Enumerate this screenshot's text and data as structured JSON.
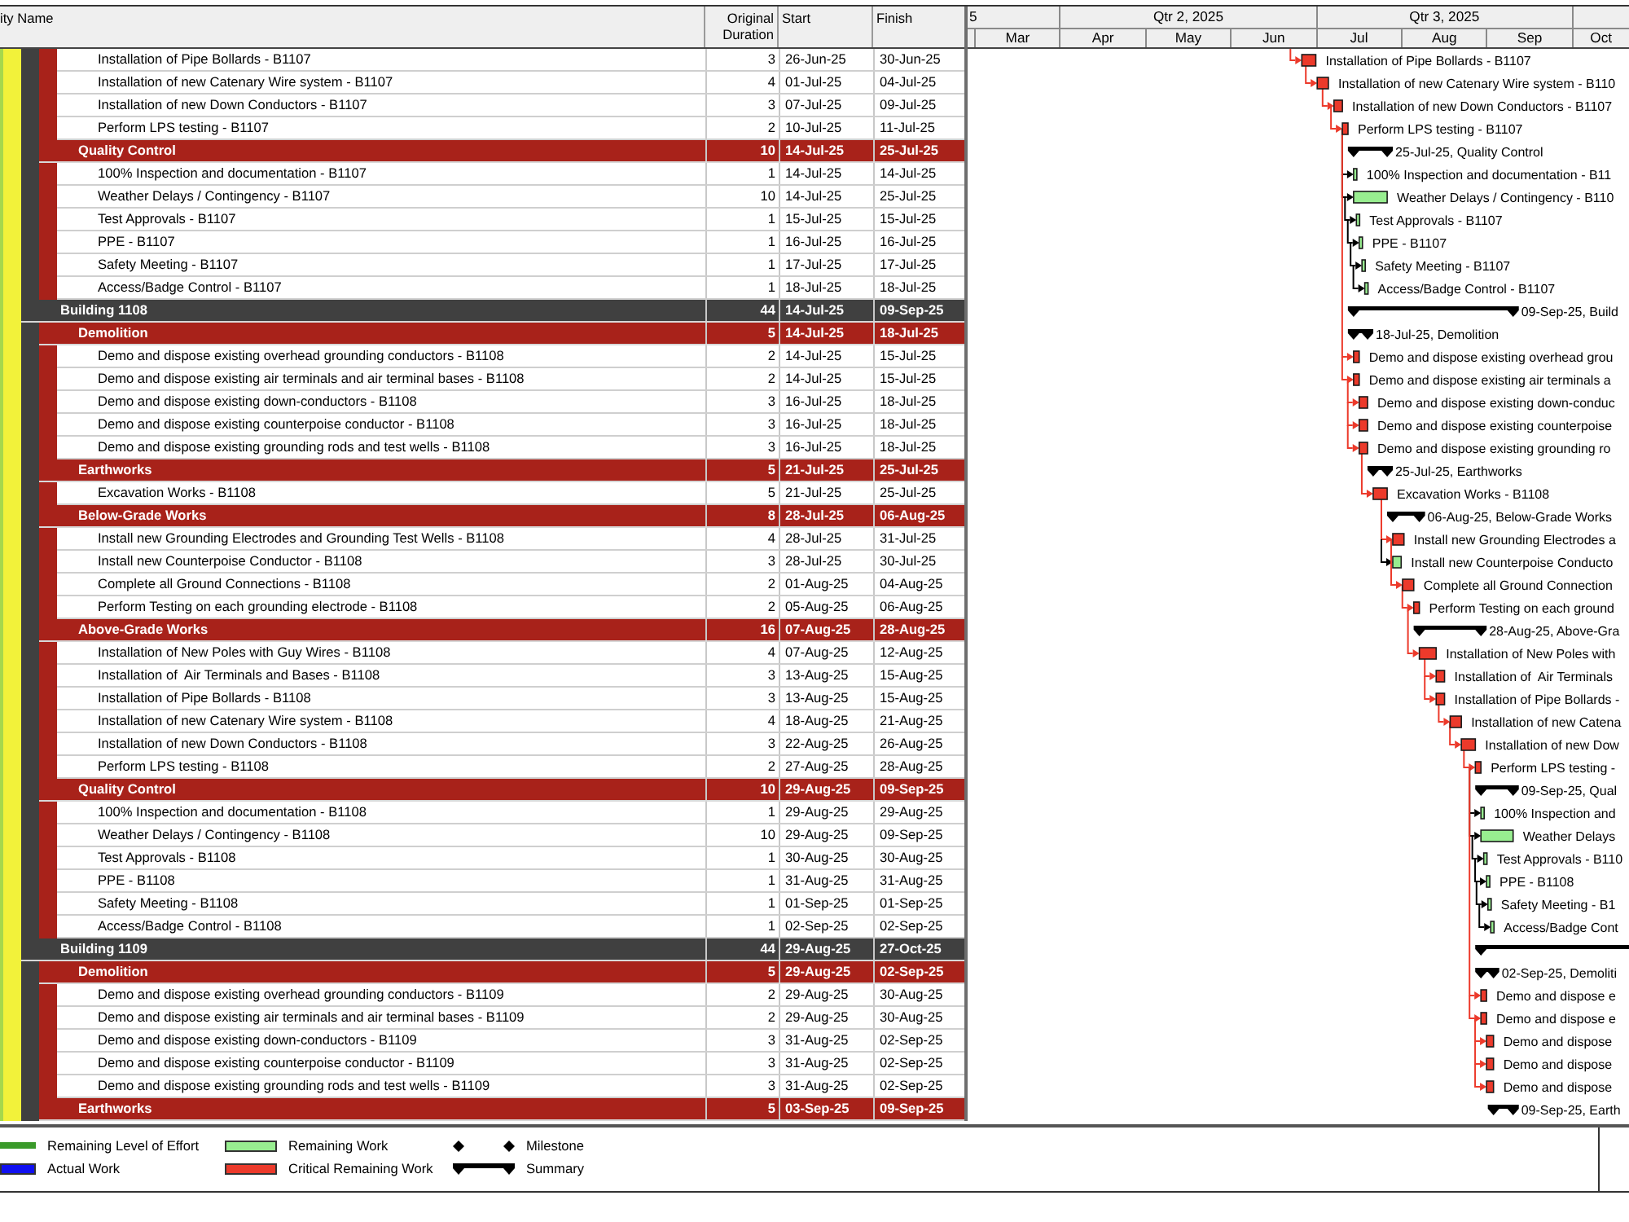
{
  "table": {
    "columns": [
      "ity Name",
      "Original Duration",
      "Start",
      "Finish"
    ],
    "groups": [
      {
        "children": [
          {
            "children": [
              {
                "name": "Installation of Pipe Bollards - B1107",
                "duration": "3",
                "start": "26-Jun-25",
                "finish": "30-Jun-25",
                "bar": {
                  "kind": "critical",
                  "label": "Installation of Pipe Bollards - B1107"
                }
              },
              {
                "name": "Installation of new Catenary Wire system - B1107",
                "duration": "4",
                "start": "01-Jul-25",
                "finish": "04-Jul-25",
                "bar": {
                  "kind": "critical",
                  "label": "Installation of new Catenary Wire system - B110"
                }
              },
              {
                "name": "Installation of new Down Conductors - B1107",
                "duration": "3",
                "start": "07-Jul-25",
                "finish": "09-Jul-25",
                "bar": {
                  "kind": "critical",
                  "label": "Installation of new Down Conductors - B1107"
                }
              },
              {
                "name": "Perform LPS testing - B1107",
                "duration": "2",
                "start": "10-Jul-25",
                "finish": "11-Jul-25",
                "bar": {
                  "kind": "critical",
                  "label": "Perform LPS testing - B1107"
                }
              }
            ]
          },
          {
            "name": "Quality Control",
            "duration": "10",
            "start": "14-Jul-25",
            "finish": "25-Jul-25",
            "bar": {
              "kind": "summary",
              "label": "25-Jul-25, Quality Control"
            },
            "children": [
              {
                "name": "100% Inspection and documentation - B1107",
                "duration": "1",
                "start": "14-Jul-25",
                "finish": "14-Jul-25",
                "bar": {
                  "kind": "remaining",
                  "label": "100% Inspection and documentation - B11"
                }
              },
              {
                "name": "Weather Delays / Contingency - B1107",
                "duration": "10",
                "start": "14-Jul-25",
                "finish": "25-Jul-25",
                "bar": {
                  "kind": "remaining",
                  "label": "Weather Delays / Contingency - B110"
                }
              },
              {
                "name": "Test Approvals - B1107",
                "duration": "1",
                "start": "15-Jul-25",
                "finish": "15-Jul-25",
                "bar": {
                  "kind": "remaining",
                  "label": "Test Approvals - B1107"
                }
              },
              {
                "name": "PPE - B1107",
                "duration": "1",
                "start": "16-Jul-25",
                "finish": "16-Jul-25",
                "bar": {
                  "kind": "remaining",
                  "label": "PPE - B1107"
                }
              },
              {
                "name": "Safety Meeting - B1107",
                "duration": "1",
                "start": "17-Jul-25",
                "finish": "17-Jul-25",
                "bar": {
                  "kind": "remaining",
                  "label": "Safety Meeting - B1107"
                }
              },
              {
                "name": "Access/Badge Control - B1107",
                "duration": "1",
                "start": "18-Jul-25",
                "finish": "18-Jul-25",
                "bar": {
                  "kind": "remaining",
                  "label": "Access/Badge Control - B1107"
                }
              }
            ]
          }
        ]
      },
      {
        "name": "Building 1108",
        "duration": "44",
        "start": "14-Jul-25",
        "finish": "09-Sep-25",
        "bar": {
          "kind": "summary",
          "label": "09-Sep-25, Build"
        },
        "children": [
          {
            "name": "Demolition",
            "duration": "5",
            "start": "14-Jul-25",
            "finish": "18-Jul-25",
            "bar": {
              "kind": "summary",
              "label": "18-Jul-25, Demolition"
            },
            "children": [
              {
                "name": "Demo and dispose existing overhead grounding conductors - B1108",
                "duration": "2",
                "start": "14-Jul-25",
                "finish": "15-Jul-25",
                "bar": {
                  "kind": "critical",
                  "label": "Demo and dispose existing overhead grou"
                }
              },
              {
                "name": "Demo and dispose existing air terminals and air terminal bases - B1108",
                "duration": "2",
                "start": "14-Jul-25",
                "finish": "15-Jul-25",
                "bar": {
                  "kind": "critical",
                  "label": "Demo and dispose existing air terminals a"
                }
              },
              {
                "name": "Demo and dispose existing down-conductors - B1108",
                "duration": "3",
                "start": "16-Jul-25",
                "finish": "18-Jul-25",
                "bar": {
                  "kind": "critical",
                  "label": "Demo and dispose existing down-conduc"
                }
              },
              {
                "name": "Demo and dispose existing counterpoise conductor - B1108",
                "duration": "3",
                "start": "16-Jul-25",
                "finish": "18-Jul-25",
                "bar": {
                  "kind": "critical",
                  "label": "Demo and dispose existing counterpoise"
                }
              },
              {
                "name": "Demo and dispose existing grounding rods and test wells - B1108",
                "duration": "3",
                "start": "16-Jul-25",
                "finish": "18-Jul-25",
                "bar": {
                  "kind": "critical",
                  "label": "Demo and dispose existing grounding ro"
                }
              }
            ]
          },
          {
            "name": "Earthworks",
            "duration": "5",
            "start": "21-Jul-25",
            "finish": "25-Jul-25",
            "bar": {
              "kind": "summary",
              "label": "25-Jul-25, Earthworks"
            },
            "children": [
              {
                "name": "Excavation Works - B1108",
                "duration": "5",
                "start": "21-Jul-25",
                "finish": "25-Jul-25",
                "bar": {
                  "kind": "critical",
                  "label": "Excavation Works - B1108"
                }
              }
            ]
          },
          {
            "name": "Below-Grade Works",
            "duration": "8",
            "start": "28-Jul-25",
            "finish": "06-Aug-25",
            "bar": {
              "kind": "summary",
              "label": "06-Aug-25, Below-Grade Works"
            },
            "children": [
              {
                "name": "Install new Grounding Electrodes and Grounding Test Wells - B1108",
                "duration": "4",
                "start": "28-Jul-25",
                "finish": "31-Jul-25",
                "bar": {
                  "kind": "critical",
                  "label": "Install new Grounding Electrodes a"
                }
              },
              {
                "name": "Install new Counterpoise Conductor - B1108",
                "duration": "3",
                "start": "28-Jul-25",
                "finish": "30-Jul-25",
                "bar": {
                  "kind": "remaining",
                  "label": "Install new Counterpoise Conducto"
                }
              },
              {
                "name": "Complete all Ground Connections - B1108",
                "duration": "2",
                "start": "01-Aug-25",
                "finish": "04-Aug-25",
                "bar": {
                  "kind": "critical",
                  "label": "Complete all Ground Connection"
                }
              },
              {
                "name": "Perform Testing on each grounding electrode - B1108",
                "duration": "2",
                "start": "05-Aug-25",
                "finish": "06-Aug-25",
                "bar": {
                  "kind": "critical",
                  "label": "Perform Testing on each ground"
                }
              }
            ]
          },
          {
            "name": "Above-Grade Works",
            "duration": "16",
            "start": "07-Aug-25",
            "finish": "28-Aug-25",
            "bar": {
              "kind": "summary",
              "label": "28-Aug-25, Above-Gra"
            },
            "children": [
              {
                "name": "Installation of New Poles with Guy Wires - B1108",
                "duration": "4",
                "start": "07-Aug-25",
                "finish": "12-Aug-25",
                "bar": {
                  "kind": "critical",
                  "label": "Installation of New Poles with"
                }
              },
              {
                "name": "Installation of  Air Terminals and Bases - B1108",
                "duration": "3",
                "start": "13-Aug-25",
                "finish": "15-Aug-25",
                "bar": {
                  "kind": "critical",
                  "label": "Installation of  Air Terminals"
                }
              },
              {
                "name": "Installation of Pipe Bollards - B1108",
                "duration": "3",
                "start": "13-Aug-25",
                "finish": "15-Aug-25",
                "bar": {
                  "kind": "critical",
                  "label": "Installation of Pipe Bollards -"
                }
              },
              {
                "name": "Installation of new Catenary Wire system - B1108",
                "duration": "4",
                "start": "18-Aug-25",
                "finish": "21-Aug-25",
                "bar": {
                  "kind": "critical",
                  "label": "Installation of new Catena"
                }
              },
              {
                "name": "Installation of new Down Conductors - B1108",
                "duration": "3",
                "start": "22-Aug-25",
                "finish": "26-Aug-25",
                "bar": {
                  "kind": "critical",
                  "label": "Installation of new Dow"
                }
              },
              {
                "name": "Perform LPS testing - B1108",
                "duration": "2",
                "start": "27-Aug-25",
                "finish": "28-Aug-25",
                "bar": {
                  "kind": "critical",
                  "label": "Perform LPS testing -"
                }
              }
            ]
          },
          {
            "name": "Quality Control",
            "duration": "10",
            "start": "29-Aug-25",
            "finish": "09-Sep-25",
            "bar": {
              "kind": "summary",
              "label": "09-Sep-25, Qual"
            },
            "children": [
              {
                "name": "100% Inspection and documentation - B1108",
                "duration": "1",
                "start": "29-Aug-25",
                "finish": "29-Aug-25",
                "bar": {
                  "kind": "remaining",
                  "label": "100% Inspection and"
                }
              },
              {
                "name": "Weather Delays / Contingency - B1108",
                "duration": "10",
                "start": "29-Aug-25",
                "finish": "09-Sep-25",
                "bar": {
                  "kind": "remaining",
                  "label": "Weather Delays"
                }
              },
              {
                "name": "Test Approvals - B1108",
                "duration": "1",
                "start": "30-Aug-25",
                "finish": "30-Aug-25",
                "bar": {
                  "kind": "remaining",
                  "label": "Test Approvals - B110"
                }
              },
              {
                "name": "PPE - B1108",
                "duration": "1",
                "start": "31-Aug-25",
                "finish": "31-Aug-25",
                "bar": {
                  "kind": "remaining",
                  "label": "PPE - B1108"
                }
              },
              {
                "name": "Safety Meeting - B1108",
                "duration": "1",
                "start": "01-Sep-25",
                "finish": "01-Sep-25",
                "bar": {
                  "kind": "remaining",
                  "label": "Safety Meeting - B1"
                }
              },
              {
                "name": "Access/Badge Control - B1108",
                "duration": "1",
                "start": "02-Sep-25",
                "finish": "02-Sep-25",
                "bar": {
                  "kind": "remaining",
                  "label": "Access/Badge Cont"
                }
              }
            ]
          }
        ]
      },
      {
        "name": "Building 1109",
        "duration": "44",
        "start": "29-Aug-25",
        "finish": "27-Oct-25",
        "bar": {
          "kind": "summary"
        },
        "children": [
          {
            "name": "Demolition",
            "duration": "5",
            "start": "29-Aug-25",
            "finish": "02-Sep-25",
            "bar": {
              "kind": "summary",
              "label": "02-Sep-25, Demoliti"
            },
            "children": [
              {
                "name": "Demo and dispose existing overhead grounding conductors - B1109",
                "duration": "2",
                "start": "29-Aug-25",
                "finish": "30-Aug-25",
                "bar": {
                  "kind": "critical",
                  "label": "Demo and dispose e"
                }
              },
              {
                "name": "Demo and dispose existing air terminals and air terminal bases - B1109",
                "duration": "2",
                "start": "29-Aug-25",
                "finish": "30-Aug-25",
                "bar": {
                  "kind": "critical",
                  "label": "Demo and dispose e"
                }
              },
              {
                "name": "Demo and dispose existing down-conductors - B1109",
                "duration": "3",
                "start": "31-Aug-25",
                "finish": "02-Sep-25",
                "bar": {
                  "kind": "critical",
                  "label": "Demo and dispose"
                }
              },
              {
                "name": "Demo and dispose existing counterpoise conductor - B1109",
                "duration": "3",
                "start": "31-Aug-25",
                "finish": "02-Sep-25",
                "bar": {
                  "kind": "critical",
                  "label": "Demo and dispose"
                }
              },
              {
                "name": "Demo and dispose existing grounding rods and test wells - B1109",
                "duration": "3",
                "start": "31-Aug-25",
                "finish": "02-Sep-25",
                "bar": {
                  "kind": "critical",
                  "label": "Demo and dispose"
                }
              }
            ]
          },
          {
            "name": "Earthworks",
            "duration": "5",
            "start": "03-Sep-25",
            "finish": "09-Sep-25",
            "bar": {
              "kind": "summary",
              "label": "09-Sep-25, Earth"
            }
          }
        ]
      }
    ]
  },
  "timescale": {
    "quarters": [
      {
        "label": "5",
        "months": [
          "Mar"
        ]
      },
      {
        "label": "Qtr 2, 2025",
        "months": [
          "Apr",
          "May",
          "Jun"
        ]
      },
      {
        "label": "Qtr 3, 2025",
        "months": [
          "Jul",
          "Aug",
          "Sep"
        ]
      },
      {
        "months": [
          "Oct"
        ]
      }
    ]
  },
  "legend": [
    {
      "kind": "level_of_effort",
      "label": "Remaining Level of Effort",
      "color": "#3a9a2a"
    },
    {
      "kind": "actual",
      "label": "Actual Work",
      "color": "#1010f0"
    },
    {
      "kind": "remaining",
      "label": "Remaining Work",
      "color": "#98ee90"
    },
    {
      "kind": "critical",
      "label": "Critical Remaining Work",
      "color": "#ec3a2b"
    },
    {
      "kind": "milestone",
      "label": "Milestone"
    },
    {
      "kind": "summary",
      "label": "Summary"
    }
  ]
}
